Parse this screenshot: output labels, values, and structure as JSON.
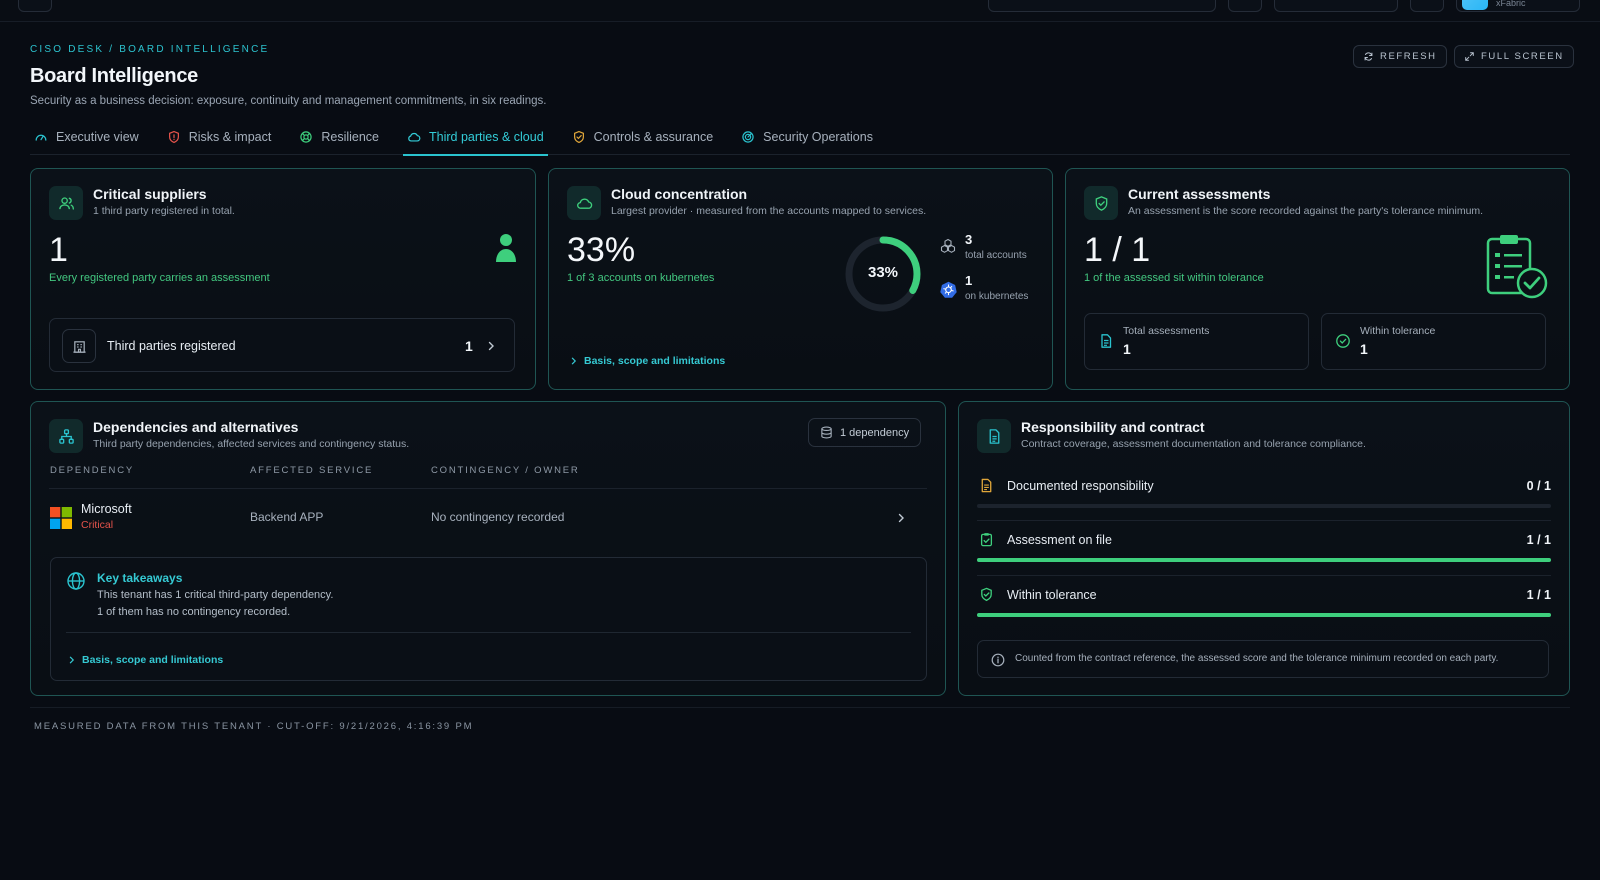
{
  "topbar": {
    "user_name": "xFabric"
  },
  "header": {
    "breadcrumb": "CISO DESK / BOARD INTELLIGENCE",
    "title": "Board Intelligence",
    "subtitle": "Security as a business decision: exposure, continuity and management commitments, in six readings.",
    "refresh_label": "REFRESH",
    "fullscreen_label": "FULL SCREEN"
  },
  "tabs": [
    {
      "label": "Executive view",
      "icon": "gauge-icon",
      "active": false
    },
    {
      "label": "Risks & impact",
      "icon": "shield-alert-icon",
      "active": false
    },
    {
      "label": "Resilience",
      "icon": "lifebuoy-icon",
      "active": false
    },
    {
      "label": "Third parties & cloud",
      "icon": "cloud-icon",
      "active": true
    },
    {
      "label": "Controls & assurance",
      "icon": "shield-check-icon",
      "active": false
    },
    {
      "label": "Security Operations",
      "icon": "radar-icon",
      "active": false
    }
  ],
  "critical_suppliers": {
    "title": "Critical suppliers",
    "subtitle": "1 third party registered in total.",
    "value": "1",
    "note": "Every registered party carries an assessment",
    "row_label": "Third parties registered",
    "row_value": "1"
  },
  "cloud_concentration": {
    "title": "Cloud concentration",
    "subtitle": "Largest provider · measured from the accounts mapped to services.",
    "value": "33%",
    "note": "1 of 3 accounts on kubernetes",
    "donut_label": "33%",
    "donut_fraction": 0.33,
    "total_accounts_value": "3",
    "total_accounts_label": "total accounts",
    "provider_value": "1",
    "provider_label": "on kubernetes",
    "link": "Basis, scope and limitations"
  },
  "current_assessments": {
    "title": "Current assessments",
    "subtitle": "An assessment is the score recorded against the party's tolerance minimum.",
    "value": "1 / 1",
    "note": "1 of the assessed sit within tolerance",
    "total_label": "Total assessments",
    "total_value": "1",
    "within_label": "Within tolerance",
    "within_value": "1"
  },
  "dependencies": {
    "title": "Dependencies and alternatives",
    "subtitle": "Third party dependencies, affected services and contingency status.",
    "badge": "1 dependency",
    "columns": [
      "DEPENDENCY",
      "AFFECTED SERVICE",
      "CONTINGENCY / OWNER"
    ],
    "rows": [
      {
        "name": "Microsoft",
        "criticality": "Critical",
        "service": "Backend APP",
        "contingency": "No contingency recorded"
      }
    ],
    "takeaways_title": "Key takeaways",
    "takeaways": [
      "This tenant has 1 critical third-party dependency.",
      "1 of them has no contingency recorded."
    ],
    "link": "Basis, scope and limitations"
  },
  "responsibility": {
    "title": "Responsibility and contract",
    "subtitle": "Contract coverage, assessment documentation and tolerance compliance.",
    "rows": [
      {
        "label": "Documented responsibility",
        "value": "0 / 1",
        "fraction": 0,
        "icon": "document-icon",
        "color": "#e0a63a"
      },
      {
        "label": "Assessment on file",
        "value": "1 / 1",
        "fraction": 1,
        "icon": "clipboard-check-icon",
        "color": "#3ecf7d"
      },
      {
        "label": "Within tolerance",
        "value": "1 / 1",
        "fraction": 1,
        "icon": "shield-check-icon",
        "color": "#3ecf7d"
      }
    ],
    "info_note": "Counted from the contract reference, the assessed score and the tolerance minimum recorded on each party."
  },
  "footer": {
    "text": "MEASURED DATA FROM THIS TENANT · CUT-OFF: 9/21/2026, 4:16:39 PM"
  },
  "colors": {
    "accent": "#2ac3cf",
    "success": "#3ecf7d",
    "danger": "#e5534b",
    "warning": "#e0a63a"
  }
}
